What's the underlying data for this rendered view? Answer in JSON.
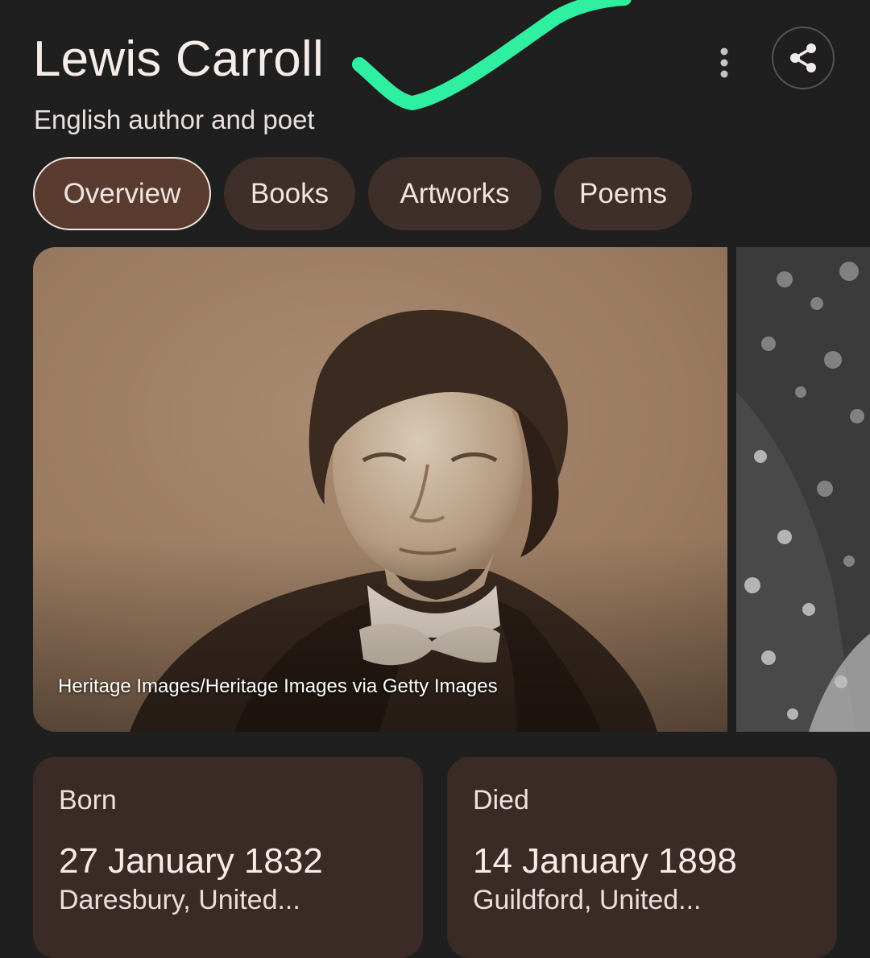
{
  "header": {
    "title": "Lewis Carroll",
    "subtitle": "English author and poet"
  },
  "actions": {
    "more_icon": "more-vertical-icon",
    "share_icon": "share-icon"
  },
  "tabs": [
    {
      "label": "Overview",
      "active": true
    },
    {
      "label": "Books",
      "active": false
    },
    {
      "label": "Artworks",
      "active": false
    },
    {
      "label": "Poems",
      "active": false
    }
  ],
  "gallery": {
    "main_image_credit": "Heritage Images/Heritage Images via Getty Images"
  },
  "facts": {
    "born": {
      "label": "Born",
      "date": "27 January 1832",
      "place": "Daresbury, United..."
    },
    "died": {
      "label": "Died",
      "date": "14 January 1898",
      "place": "Guildford, United..."
    }
  },
  "colors": {
    "background": "#1f1f1f",
    "tab_background": "#3f2f2a",
    "tab_active_background": "#5a3b30",
    "card_background": "#3a2b27",
    "annotation_check": "#2ef0a0"
  }
}
